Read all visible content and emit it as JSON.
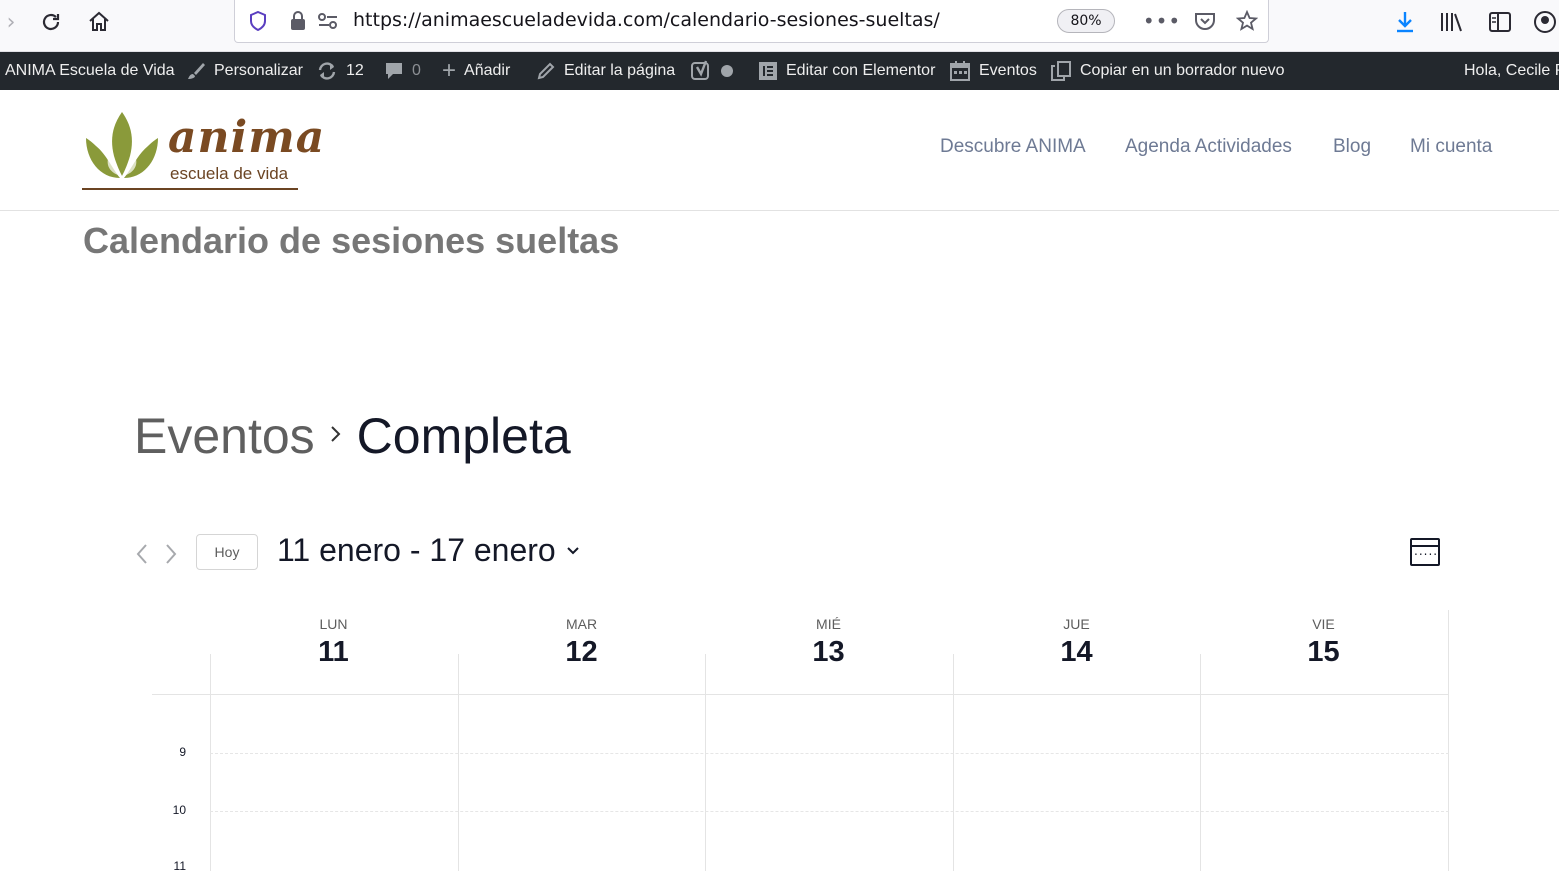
{
  "browser": {
    "url": "https://animaescueladevida.com/calendario-sesiones-sueltas/",
    "zoom": "80%"
  },
  "admin_bar": {
    "site_name": "ANIMA Escuela de Vida",
    "customize": "Personalizar",
    "updates_count": "12",
    "comments_count": "0",
    "add_new": "Añadir",
    "edit_page": "Editar la página",
    "elementor": "Editar con Elementor",
    "events": "Eventos",
    "copy_draft": "Copiar en un borrador nuevo",
    "greeting": "Hola, Cecile Pi"
  },
  "site": {
    "logo_word": "anima",
    "logo_sub": "escuela de vida",
    "nav": [
      "Descubre ANIMA",
      "Agenda Actividades",
      "Blog",
      "Mi cuenta"
    ]
  },
  "page": {
    "title": "Calendario de sesiones sueltas"
  },
  "calendar": {
    "breadcrumb_link": "Eventos",
    "breadcrumb_current": "Completa",
    "today_label": "Hoy",
    "date_range": "11 enero - 17 enero",
    "days": [
      {
        "name": "LUN",
        "num": "11"
      },
      {
        "name": "MAR",
        "num": "12"
      },
      {
        "name": "MIÉ",
        "num": "13"
      },
      {
        "name": "JUE",
        "num": "14"
      },
      {
        "name": "VIE",
        "num": "15"
      }
    ],
    "hours": [
      "9",
      "10",
      "11"
    ]
  },
  "colors": {
    "admin_bar": "#23282d",
    "logo_green": "#8a9a3a",
    "logo_brown": "#7a4a22",
    "nav_text": "#6e7a94"
  }
}
